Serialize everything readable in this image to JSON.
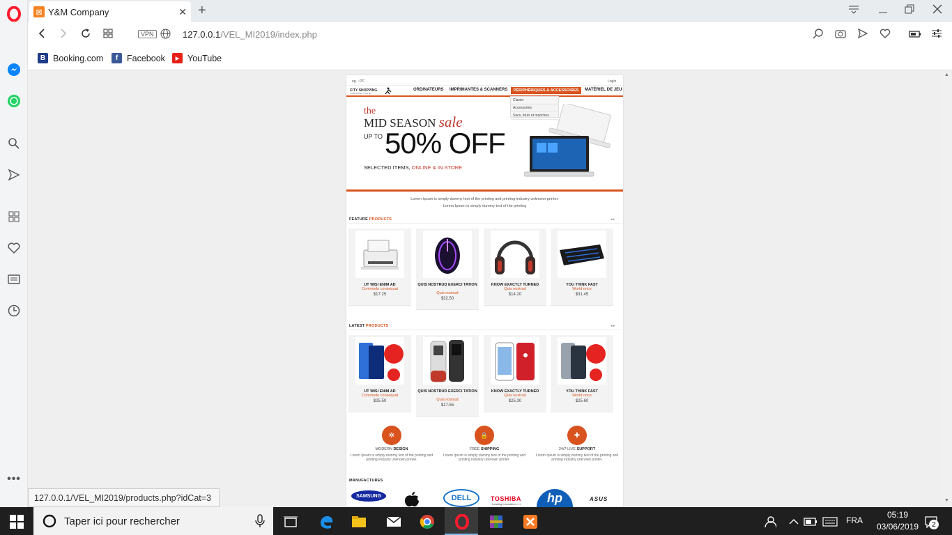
{
  "browser": {
    "tab_title": "Y&M Company",
    "url_host": "127.0.0.1",
    "url_path": "/VEL_MI2019/index.php",
    "vpn_label": "VPN",
    "bookmarks": [
      {
        "label": "Booking.com",
        "icon": "B",
        "color": "#1f3c88"
      },
      {
        "label": "Facebook",
        "icon": "f",
        "color": "#3b5998"
      },
      {
        "label": "YouTube",
        "icon": "▶",
        "color": "#e62117"
      }
    ],
    "status_url": "127.0.0.1/VEL_MI2019/products.php?idCat=3"
  },
  "site": {
    "search_placeholder": "eg. : PC",
    "login": "Login",
    "logo_text": "CITY SHOPPING",
    "logo_tagline": "YOUR BUDGET YOUR BE",
    "menu": [
      "ORDINATEURS",
      "IMPRIMANTES & SCANNERS",
      "PÉRIPHÉRIQUES & ACCESSOIRES",
      "MATÉRIEL DE JEU"
    ],
    "dropdown": [
      "Clavier",
      "Accessoires",
      "Sacs, étuis et manches"
    ],
    "banner": {
      "the": "the",
      "mid_season": "MID SEASON",
      "sale": "sale",
      "up_to": "UP TO",
      "percent": "50% OFF",
      "selected_items": "SELECTED ITEMS,",
      "online_store": "ONLINE & IN STORE"
    },
    "intro_line1": "Lorem Ipsum is simply dummy text of the printing and printing industry unknown printer.",
    "intro_line2": "Lorem Ipsum is simply dummy text of the printing",
    "feature_title": {
      "a": "FEATURE",
      "b": "PRODUCTS"
    },
    "feature_products": [
      {
        "name": "UT WISI ENIM AD",
        "sub": "Commodo consequat",
        "price": "$17.25",
        "icon": "printer"
      },
      {
        "name": "QUIS NOSTRUD EXERCI TATION",
        "sub": "Quis nostrud",
        "price": "$32.50",
        "icon": "mouse"
      },
      {
        "name": "KNOW EXACTLY TURNED",
        "sub": "Quis nostrud",
        "price": "$14.20",
        "icon": "headphones"
      },
      {
        "name": "YOU THINK FAST",
        "sub": "World once",
        "price": "$31.45",
        "icon": "keyboard"
      }
    ],
    "latest_title": {
      "a": "LATEST",
      "b": "PRODUCTS"
    },
    "latest_products": [
      {
        "name": "UT WISI ENIM AD",
        "sub": "Commodo consequat",
        "price": "$25.50",
        "icon": "phone-blue"
      },
      {
        "name": "QUIS NOSTRUD EXERCI TATION",
        "sub": "Quis nostrud",
        "price": "$17.55",
        "icon": "feature-phone"
      },
      {
        "name": "KNOW EXACTLY TURNED",
        "sub": "Quis nostrud",
        "price": "$25.30",
        "icon": "iphone-red"
      },
      {
        "name": "YOU THINK FAST",
        "sub": "World once",
        "price": "$25.60",
        "icon": "phone-silver"
      }
    ],
    "features": [
      {
        "light": "MODERN",
        "bold": "DESIGN",
        "text": "Lorem Ipsum is simply dummy text of the printing and printing industry unknown printer.",
        "icon": "✲"
      },
      {
        "light": "FREE",
        "bold": "SHIPPING",
        "text": "Lorem Ipsum is simply dummy text of the printing and printing industry unknown printer.",
        "icon": "🔒"
      },
      {
        "light": "24/7 LIVE",
        "bold": "SUPPORT",
        "text": "Lorem Ipsum is simply dummy text of the printing and printing industry unknown printer.",
        "icon": "✚"
      }
    ],
    "manufacturers_title": "MANUFACTURES",
    "brands": [
      "SAMSUNG",
      "DELL",
      "TOSHIBA",
      "hp",
      "ASUS"
    ],
    "toshiba_tagline": "Leading Innovation >>>"
  },
  "taskbar": {
    "search_placeholder": "Taper ici pour rechercher",
    "language": "FRA",
    "time": "05:19",
    "date": "03/06/2019",
    "notifications": "2"
  },
  "colors": {
    "accent": "#d9531e",
    "opera_red": "#ff1b2d"
  }
}
